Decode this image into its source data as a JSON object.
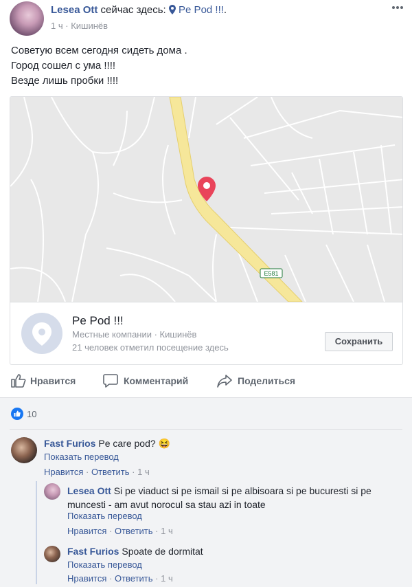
{
  "post": {
    "author": "Lesea Ott",
    "checkin_text": "сейчас здесь:",
    "place": "Pe Pod !!!",
    "time": "1 ч",
    "location": "Кишинёв",
    "body_lines": [
      "Советую всем сегодня сидеть дома .",
      "Город сошел с ума !!!!",
      "Везде лишь пробки !!!!"
    ]
  },
  "map": {
    "road_label": "E581",
    "colors": {
      "road": "#f6e79a",
      "bg": "#e8e8e8",
      "pin": "#e9445a"
    }
  },
  "place_card": {
    "title": "Pe Pod !!!",
    "category": "Местные компании · Кишинёв",
    "checkins": "21 человек отметил посещение здесь",
    "save_label": "Сохранить"
  },
  "actions": {
    "like": "Нравится",
    "comment": "Комментарий",
    "share": "Поделиться"
  },
  "reactions": {
    "count": "10"
  },
  "comments": [
    {
      "author": "Fast Furios",
      "text": "Pe care pod? 😆",
      "translate": "Показать перевод",
      "like": "Нравится",
      "reply": "Ответить",
      "time": "1 ч"
    },
    {
      "author": "Lesea Ott",
      "text": "Si pe viaduct si pe ismail si pe albisoara si pe bucuresti si pe muncesti - am avut norocul sa stau azi in toate",
      "translate": "Показать перевод",
      "like": "Нравится",
      "reply": "Ответить",
      "time": "1 ч"
    },
    {
      "author": "Fast Furios",
      "text": "Spoate de dormitat",
      "translate": "Показать перевод",
      "like": "Нравится",
      "reply": "Ответить",
      "time": "1 ч"
    }
  ]
}
